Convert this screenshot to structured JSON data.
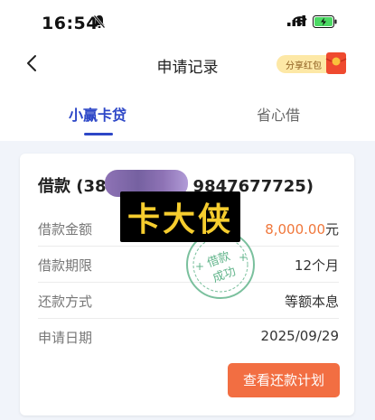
{
  "status_bar": {
    "time": "16:54"
  },
  "nav": {
    "title": "申请记录",
    "share_label": "分享红包"
  },
  "tabs": [
    {
      "label": "小赢卡贷",
      "active": true
    },
    {
      "label": "省心借",
      "active": false
    }
  ],
  "card": {
    "title": "借款 (38",
    "title_tail": "9847677725)",
    "rows": [
      {
        "label": "借款金额",
        "value": "8,000.00",
        "unit": "元"
      },
      {
        "label": "借款期限",
        "value": "12个月"
      },
      {
        "label": "还款方式",
        "value": "等额本息"
      },
      {
        "label": "申请日期",
        "value": "2025/09/29"
      }
    ],
    "button_label": "查看还款计划",
    "stamp_text_1": "借款",
    "stamp_text_2": "成功"
  },
  "watermark": {
    "text": "卡大侠"
  },
  "colors": {
    "accent_blue": "#2d47c7",
    "amount_orange": "#f0773b",
    "button_orange": "#f26e42"
  }
}
